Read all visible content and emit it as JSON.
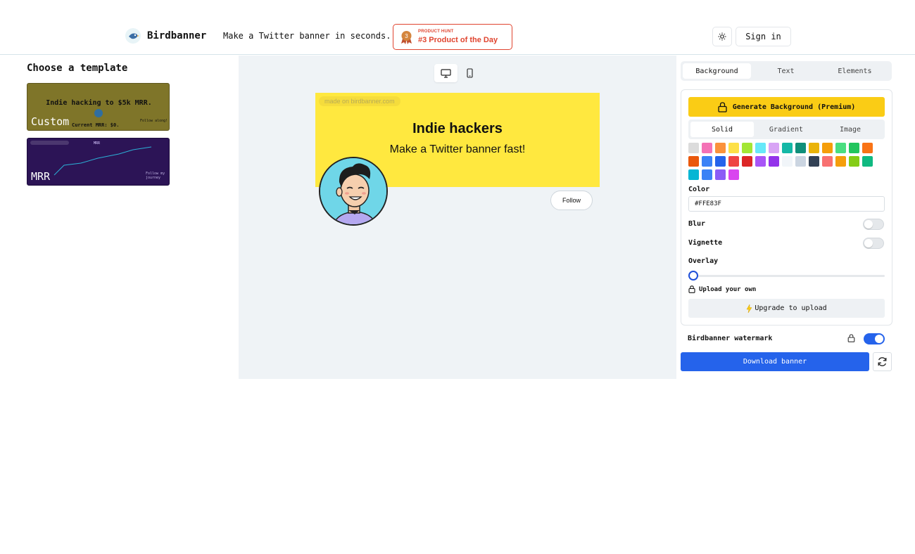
{
  "header": {
    "brand": "Birdbanner",
    "tagline": "Make a Twitter banner in seconds.",
    "badge_small": "PRODUCT HUNT",
    "badge_big": "#3 Product of the Day",
    "badge_rank": "3",
    "signin_label": "Sign in"
  },
  "sidebar": {
    "title": "Choose a template",
    "templates": [
      {
        "label": "Custom",
        "text": "Indie hacking to $5k MRR.",
        "sub": "Current MRR: $0.",
        "follow": "Follow along!"
      },
      {
        "label": "MRR",
        "chart_title": "MRR",
        "follow": "Follow my journey"
      }
    ]
  },
  "canvas": {
    "watermark": "made on birdbanner.com",
    "title": "Indie hackers",
    "subtitle": "Make a Twitter banner fast!",
    "follow_label": "Follow",
    "banner_color": "#FFE83F"
  },
  "panel": {
    "tabs": [
      "Background",
      "Text",
      "Elements"
    ],
    "generate_label": "Generate Background (Premium)",
    "subtabs": [
      "Solid",
      "Gradient",
      "Image"
    ],
    "color_label": "Color",
    "color_value": "#FFE83F",
    "blur_label": "Blur",
    "vignette_label": "Vignette",
    "overlay_label": "Overlay",
    "overlay_value": 0,
    "upload_label": "Upload your own",
    "upgrade_label": "Upgrade to upload",
    "watermark_label": "Birdbanner watermark",
    "download_label": "Download banner",
    "swatches": [
      "#dcdcdc",
      "#f472b6",
      "#fb923c",
      "#fde047",
      "#a3e635",
      "#67e8f9",
      "#d8a4f5",
      "#14b8a6",
      "#0f8f7a",
      "#eab308",
      "#f59e0b",
      "#4ade80",
      "#22c55e",
      "#f97316",
      "#ea580c",
      "#3b82f6",
      "#2563eb",
      "#ef4444",
      "#dc2626",
      "#a855f7",
      "#9333ea",
      "#f1f5f9",
      "#cbd5e1",
      "#334155",
      "#f87171",
      "#f59e0b",
      "#84cc16",
      "#10b981",
      "#06b6d4",
      "#3b82f6",
      "#8b5cf6",
      "#d946ef"
    ]
  }
}
